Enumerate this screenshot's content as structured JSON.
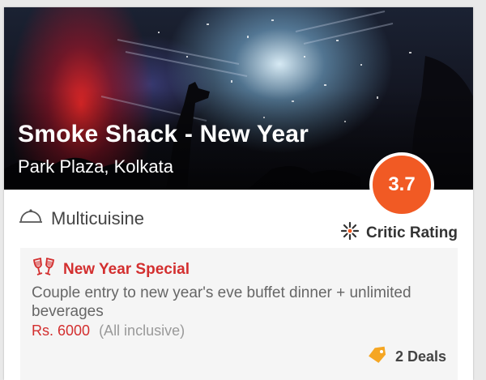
{
  "restaurant": {
    "name": "Smoke Shack - New Year",
    "location": "Park Plaza, Kolkata",
    "rating": "3.7",
    "cuisine": "Multicuisine",
    "rating_type": "Critic Rating"
  },
  "offer": {
    "title": "New Year Special",
    "description": "Couple entry to new year's eve buffet dinner + unlimited beverages",
    "price": "Rs. 6000",
    "price_note": "(All inclusive)",
    "deals_count": "2 Deals"
  },
  "icons": {
    "cuisine": "cloche-icon",
    "critic": "critic-burst-icon",
    "offer": "cheers-glasses-icon",
    "deals": "price-tag-icon"
  },
  "colors": {
    "rating_badge": "#f15a24",
    "offer_accent": "#d32f2f",
    "deals_tag": "#f5a623"
  }
}
